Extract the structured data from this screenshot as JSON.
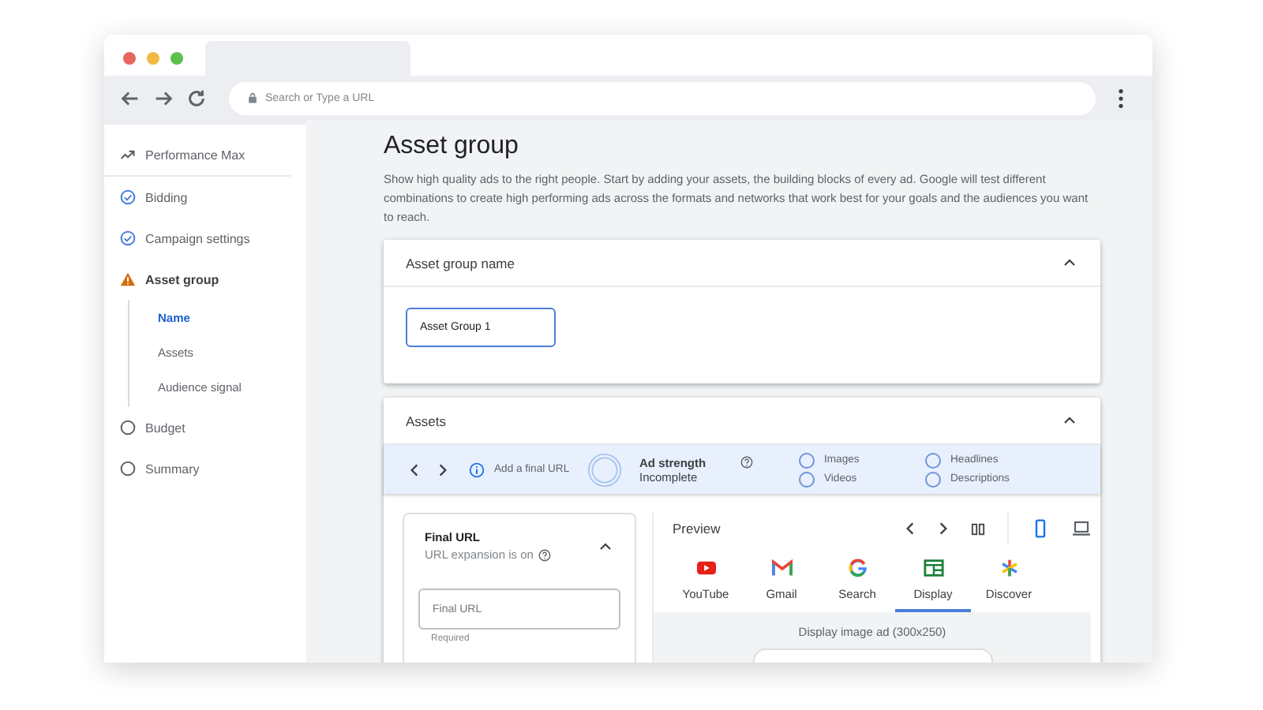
{
  "browser": {
    "address_placeholder": "Search or Type a URL"
  },
  "sidebar": {
    "items": [
      {
        "label": "Performance Max",
        "kind": "campaign",
        "selected": false
      },
      {
        "label": "Bidding",
        "kind": "done",
        "selected": false
      },
      {
        "label": "Campaign settings",
        "kind": "done",
        "selected": false
      },
      {
        "label": "Asset group",
        "kind": "warning",
        "selected": false,
        "children": [
          {
            "label": "Name",
            "selected": true
          },
          {
            "label": "Assets",
            "selected": false
          },
          {
            "label": "Audience signal",
            "selected": false
          }
        ]
      },
      {
        "label": "Budget",
        "kind": "todo",
        "selected": false
      },
      {
        "label": "Summary",
        "kind": "todo",
        "selected": false
      }
    ]
  },
  "page": {
    "title": "Asset group",
    "description": "Show high quality ads to the right people. Start by adding your assets, the building blocks of every ad. Google will test different combinations to create high performing ads across the formats and networks that work best for your goals and the audiences you want to reach."
  },
  "name_card": {
    "title": "Asset group name",
    "expanded": true,
    "value": "Asset Group 1"
  },
  "assets_card": {
    "title": "Assets",
    "expanded": true,
    "strength_bar": {
      "hint": "Add a final URL",
      "label": "Ad strength",
      "rating": "Incomplete",
      "checklist": [
        {
          "label": "Images",
          "checked": false
        },
        {
          "label": "Videos",
          "checked": false
        },
        {
          "label": "Headlines",
          "checked": false
        },
        {
          "label": "Descriptions",
          "checked": false
        }
      ]
    },
    "final_url": {
      "title": "Final URL",
      "subtitle": "URL expansion is on",
      "expanded": true,
      "placeholder": "Final URL",
      "helper": "Required"
    },
    "preview": {
      "title": "Preview",
      "devices": [
        {
          "kind": "mobile",
          "selected": true
        },
        {
          "kind": "desktop",
          "selected": false
        }
      ],
      "channels": [
        {
          "kind": "youtube",
          "label": "YouTube",
          "selected": false
        },
        {
          "kind": "gmail",
          "label": "Gmail",
          "selected": false
        },
        {
          "kind": "search",
          "label": "Search",
          "selected": false
        },
        {
          "kind": "display",
          "label": "Display",
          "selected": true
        },
        {
          "kind": "discover",
          "label": "Discover",
          "selected": false
        }
      ],
      "ad_caption": "Display image ad (300x250)"
    }
  }
}
